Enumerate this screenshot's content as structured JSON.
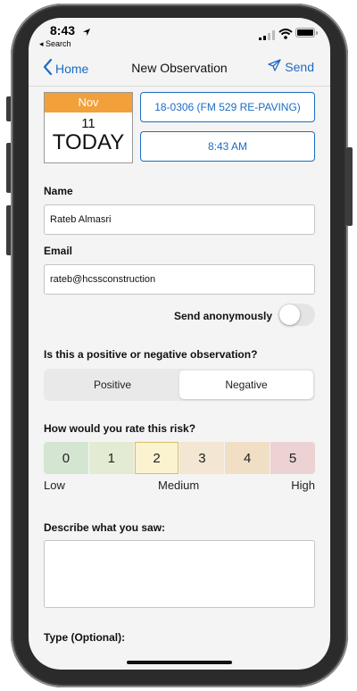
{
  "status_bar": {
    "time": "8:43",
    "back_app": "◂ Search"
  },
  "nav": {
    "back_label": "Home",
    "title": "New Observation",
    "send_label": "Send"
  },
  "date": {
    "month": "Nov",
    "day": "11",
    "label": "TODAY"
  },
  "job_button": "18-0306 (FM 529 RE-PAVING)",
  "time_button": "8:43 AM",
  "name": {
    "label": "Name",
    "value": "Rateb Almasri"
  },
  "email": {
    "label": "Email",
    "value": "rateb@hcssconstruction"
  },
  "anonymous": {
    "label": "Send anonymously",
    "enabled": false
  },
  "observation": {
    "question": "Is this a positive or negative observation?",
    "options": [
      "Positive",
      "Negative"
    ],
    "selected": "Negative"
  },
  "risk": {
    "question": "How would you rate this risk?",
    "levels": [
      {
        "value": "0",
        "color": "#d4e6d2"
      },
      {
        "value": "1",
        "color": "#e3ebd2"
      },
      {
        "value": "2",
        "color": "#fbf2cf"
      },
      {
        "value": "3",
        "color": "#f3e7d3"
      },
      {
        "value": "4",
        "color": "#f0dfc5"
      },
      {
        "value": "5",
        "color": "#ecd2d2"
      }
    ],
    "selected": "2",
    "scale_low": "Low",
    "scale_medium": "Medium",
    "scale_high": "High"
  },
  "describe": {
    "label": "Describe what you saw:",
    "value": ""
  },
  "type": {
    "label": "Type (Optional):"
  },
  "colors": {
    "accent": "#1b6cc4",
    "date_header": "#f2a03a"
  }
}
